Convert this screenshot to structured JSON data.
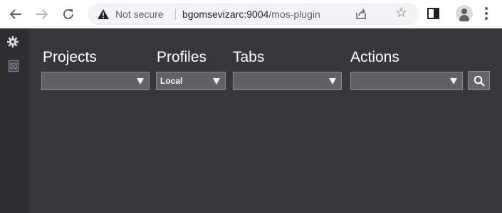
{
  "browser": {
    "security_label": "Not secure",
    "url_host": "bgomsevizarc:9004",
    "url_path": "/mos-plugin"
  },
  "sidebar": {
    "items": [
      {
        "icon": "gear-icon"
      },
      {
        "icon": "plugin-frame-icon"
      }
    ]
  },
  "filters": {
    "projects": {
      "label": "Projects",
      "value": ""
    },
    "profiles": {
      "label": "Profiles",
      "value": "Local"
    },
    "tabs": {
      "label": "Tabs",
      "value": ""
    },
    "actions": {
      "label": "Actions",
      "value": ""
    }
  },
  "colors": {
    "app_background": "#353739",
    "sidebar_background": "#2b2d2f",
    "select_background": "#5f6264",
    "browser_bar": "#ffffff"
  }
}
